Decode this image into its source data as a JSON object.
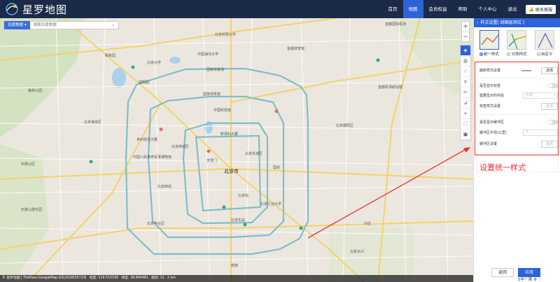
{
  "app": {
    "logo_text": "星罗地图"
  },
  "nav": {
    "items": [
      "首页",
      "地图",
      "会员权益",
      "帮助",
      "个人中心",
      "退出"
    ],
    "contact": "联系客服"
  },
  "search": {
    "source": "百度数据",
    "placeholder": "搜索百度数据"
  },
  "map": {
    "labels": [
      "北京科技大学",
      "颐和园",
      "中国海洋大学",
      "北京大学",
      "圆明园",
      "国家体育场",
      "首都体育馆",
      "北京海淀区",
      "国家体育馆",
      "首都国际机场",
      "北京朝阳区",
      "新保利大厦",
      "北京站",
      "北京西站",
      "世纪经贸大厦",
      "中国人民革命军事博物馆",
      "天安门",
      "北京东站",
      "北京工业大学",
      "南苑",
      "中国科技馆",
      "北京市",
      "国贸",
      "北京大兴",
      "石景山区",
      "首都机场航站楼",
      "北京丰台区",
      "亦庄",
      "石景山游乐园",
      "北京西城区",
      "北京东城区",
      "森林公园"
    ],
    "city_label": "北京市",
    "zoom_in": "+",
    "zoom_out": "−"
  },
  "statusbar": {
    "copyright": "© 星罗地图 | TileData-GoogleMap-GS(2018)5572号",
    "lng": "经度: 116.515165",
    "lat": "纬度: 39.844481",
    "zoom": "级别: 12",
    "scale": "2 km"
  },
  "panel": {
    "title": "样式设置[ 线图层测试 ]",
    "styles": [
      {
        "label": "统一样式",
        "active": true
      },
      {
        "label": "分类样式",
        "active": false
      },
      {
        "label": "自定义",
        "active": false
      }
    ],
    "rows": {
      "line_style": "面积样式设置",
      "line_style_btn": "选择",
      "show_label": "是否显示标签",
      "label_field": "需要显示的字段",
      "label_field_value": "名称",
      "label_style": "标签样式设置",
      "label_style_btn": "选择",
      "show_buffer": "是否显示缓冲区",
      "buffer_radius": "缓冲区半径(公里)",
      "buffer_radius_value": "0",
      "buffer_style": "缓冲区设置",
      "buffer_style_btn": "选择"
    },
    "buttons": {
      "back": "返回",
      "apply": "应用"
    }
  },
  "ime": "S中·⁰ 简 ⚙ ⋮",
  "annotation": "设置统一样式"
}
